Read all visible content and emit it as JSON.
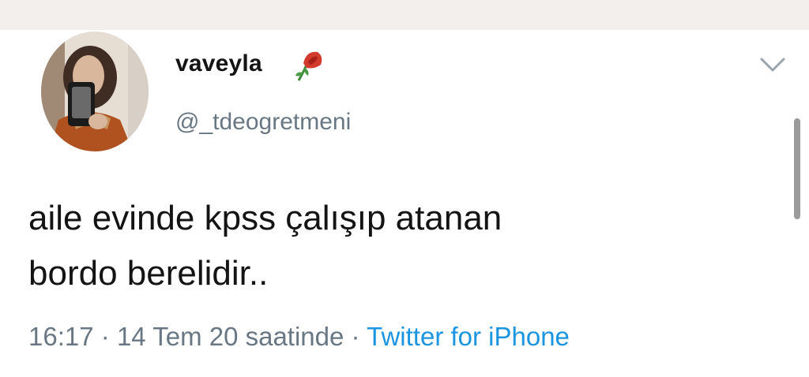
{
  "tweet": {
    "author": {
      "display_name": "vaveyla",
      "name_emoji": "wilted-rose",
      "handle": "@_tdeogretmeni"
    },
    "text": "aile evinde kpss çalışıp atanan\nbordo berelidir..",
    "time": "16:17",
    "separator": "·",
    "date": "14 Tem 20 saatinde",
    "source": "Twitter for iPhone",
    "menu_icon": "chevron-down-icon"
  },
  "colors": {
    "text": "#141414",
    "secondary": "#687783",
    "link": "#1b95e0",
    "top_band": "#f2efed"
  }
}
